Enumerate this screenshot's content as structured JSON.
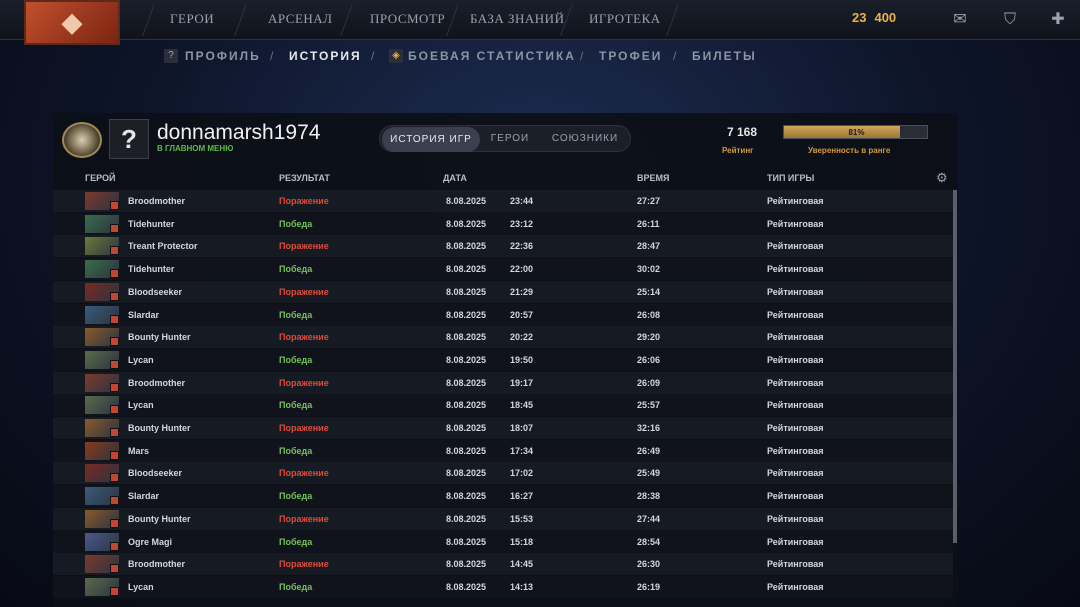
{
  "nav": {
    "logo_glyph": "◆",
    "items": [
      "ГЕРОИ",
      "АРСЕНАЛ",
      "ПРОСМОТР",
      "БАЗА ЗНАНИЙ",
      "ИГРОТЕКА"
    ],
    "currency_a": "23",
    "currency_b": "400"
  },
  "subnav": {
    "items": [
      "ПРОФИЛЬ",
      "ИСТОРИЯ",
      "БОЕВАЯ СТАТИСТИКА",
      "ТРОФЕИ",
      "БИЛЕТЫ"
    ],
    "active": "ИСТОРИЯ"
  },
  "profile": {
    "avatar_glyph": "?",
    "username": "donnamarsh1974",
    "status": "В ГЛАВНОМ МЕНЮ",
    "tabs": [
      "ИСТОРИЯ ИГР",
      "ГЕРОИ",
      "СОЮЗНИКИ"
    ],
    "rating_value": "7 168",
    "rating_label": "Рейтинг",
    "confidence_pct": "81%",
    "confidence_value": 0.81,
    "confidence_label": "Уверенность в ранге"
  },
  "table": {
    "headers": {
      "hero": "ГЕРОЙ",
      "result": "РЕЗУЛЬТАТ",
      "date": "ДАТА",
      "duration": "ВРЕМЯ",
      "mode": "ТИП ИГРЫ"
    },
    "rows": [
      {
        "hero": "Broodmother",
        "result": "Поражение",
        "win": false,
        "date": "8.08.2025",
        "time": "23:44",
        "duration": "27:27",
        "mode": "Рейтинговая"
      },
      {
        "hero": "Tidehunter",
        "result": "Победа",
        "win": true,
        "date": "8.08.2025",
        "time": "23:12",
        "duration": "26:11",
        "mode": "Рейтинговая"
      },
      {
        "hero": "Treant Protector",
        "result": "Поражение",
        "win": false,
        "date": "8.08.2025",
        "time": "22:36",
        "duration": "28:47",
        "mode": "Рейтинговая"
      },
      {
        "hero": "Tidehunter",
        "result": "Победа",
        "win": true,
        "date": "8.08.2025",
        "time": "22:00",
        "duration": "30:02",
        "mode": "Рейтинговая"
      },
      {
        "hero": "Bloodseeker",
        "result": "Поражение",
        "win": false,
        "date": "8.08.2025",
        "time": "21:29",
        "duration": "25:14",
        "mode": "Рейтинговая"
      },
      {
        "hero": "Slardar",
        "result": "Победа",
        "win": true,
        "date": "8.08.2025",
        "time": "20:57",
        "duration": "26:08",
        "mode": "Рейтинговая"
      },
      {
        "hero": "Bounty Hunter",
        "result": "Поражение",
        "win": false,
        "date": "8.08.2025",
        "time": "20:22",
        "duration": "29:20",
        "mode": "Рейтинговая"
      },
      {
        "hero": "Lycan",
        "result": "Победа",
        "win": true,
        "date": "8.08.2025",
        "time": "19:50",
        "duration": "26:06",
        "mode": "Рейтинговая"
      },
      {
        "hero": "Broodmother",
        "result": "Поражение",
        "win": false,
        "date": "8.08.2025",
        "time": "19:17",
        "duration": "26:09",
        "mode": "Рейтинговая"
      },
      {
        "hero": "Lycan",
        "result": "Победа",
        "win": true,
        "date": "8.08.2025",
        "time": "18:45",
        "duration": "25:57",
        "mode": "Рейтинговая"
      },
      {
        "hero": "Bounty Hunter",
        "result": "Поражение",
        "win": false,
        "date": "8.08.2025",
        "time": "18:07",
        "duration": "32:16",
        "mode": "Рейтинговая"
      },
      {
        "hero": "Mars",
        "result": "Победа",
        "win": true,
        "date": "8.08.2025",
        "time": "17:34",
        "duration": "26:49",
        "mode": "Рейтинговая"
      },
      {
        "hero": "Bloodseeker",
        "result": "Поражение",
        "win": false,
        "date": "8.08.2025",
        "time": "17:02",
        "duration": "25:49",
        "mode": "Рейтинговая"
      },
      {
        "hero": "Slardar",
        "result": "Победа",
        "win": true,
        "date": "8.08.2025",
        "time": "16:27",
        "duration": "28:38",
        "mode": "Рейтинговая"
      },
      {
        "hero": "Bounty Hunter",
        "result": "Поражение",
        "win": false,
        "date": "8.08.2025",
        "time": "15:53",
        "duration": "27:44",
        "mode": "Рейтинговая"
      },
      {
        "hero": "Ogre Magi",
        "result": "Победа",
        "win": true,
        "date": "8.08.2025",
        "time": "15:18",
        "duration": "28:54",
        "mode": "Рейтинговая"
      },
      {
        "hero": "Broodmother",
        "result": "Поражение",
        "win": false,
        "date": "8.08.2025",
        "time": "14:45",
        "duration": "26:30",
        "mode": "Рейтинговая"
      },
      {
        "hero": "Lycan",
        "result": "Победа",
        "win": true,
        "date": "8.08.2025",
        "time": "14:13",
        "duration": "26:19",
        "mode": "Рейтинговая"
      }
    ]
  }
}
